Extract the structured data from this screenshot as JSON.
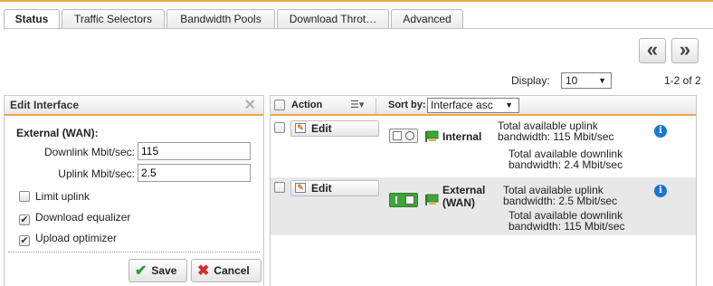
{
  "tabs": [
    {
      "label": "Status",
      "active": true
    },
    {
      "label": "Traffic Selectors",
      "active": false
    },
    {
      "label": "Bandwidth Pools",
      "active": false
    },
    {
      "label": "Download Throt…",
      "active": false
    },
    {
      "label": "Advanced",
      "active": false
    }
  ],
  "pager": {
    "prev_icon": "double-chevron-left-icon",
    "next_icon": "double-chevron-right-icon",
    "prev_glyph": "«",
    "next_glyph": "»",
    "display_label": "Display:",
    "display_value": "10",
    "range": "1-2 of 2"
  },
  "edit_panel": {
    "title": "Edit Interface",
    "interface_title": "External (WAN):",
    "downlink_label": "Downlink Mbit/sec:",
    "downlink_value": "115",
    "uplink_label": "Uplink Mbit/sec:",
    "uplink_value": "2.5",
    "limit_uplink_label": "Limit uplink",
    "limit_uplink_checked": false,
    "download_equalizer_label": "Download equalizer",
    "download_equalizer_checked": true,
    "upload_optimizer_label": "Upload optimizer",
    "upload_optimizer_checked": true,
    "save_label": "Save",
    "cancel_label": "Cancel"
  },
  "grid": {
    "action_header": "Action",
    "sort_by_label": "Sort by:",
    "sort_value": "Interface asc",
    "rows": [
      {
        "edit_label": "Edit",
        "enabled": false,
        "name_line1": "Internal",
        "name_line2": "",
        "uplink_line1": "Total available uplink",
        "uplink_line2": "bandwidth: 115 Mbit/sec",
        "downlink_line1": "Total available downlink",
        "downlink_line2": "bandwidth: 2.4 Mbit/sec"
      },
      {
        "edit_label": "Edit",
        "enabled": true,
        "name_line1": "External",
        "name_line2": "(WAN)",
        "uplink_line1": "Total available uplink",
        "uplink_line2": "bandwidth: 2.5 Mbit/sec",
        "downlink_line1": "Total available downlink",
        "downlink_line2": "bandwidth: 115 Mbit/sec"
      }
    ]
  },
  "colors": {
    "accent_orange": "#f0a64a",
    "toggle_on_green": "#3fa53a",
    "info_blue": "#1976d2",
    "save_check_green": "#2e9b2e",
    "cancel_x_red": "#d32f2f"
  }
}
